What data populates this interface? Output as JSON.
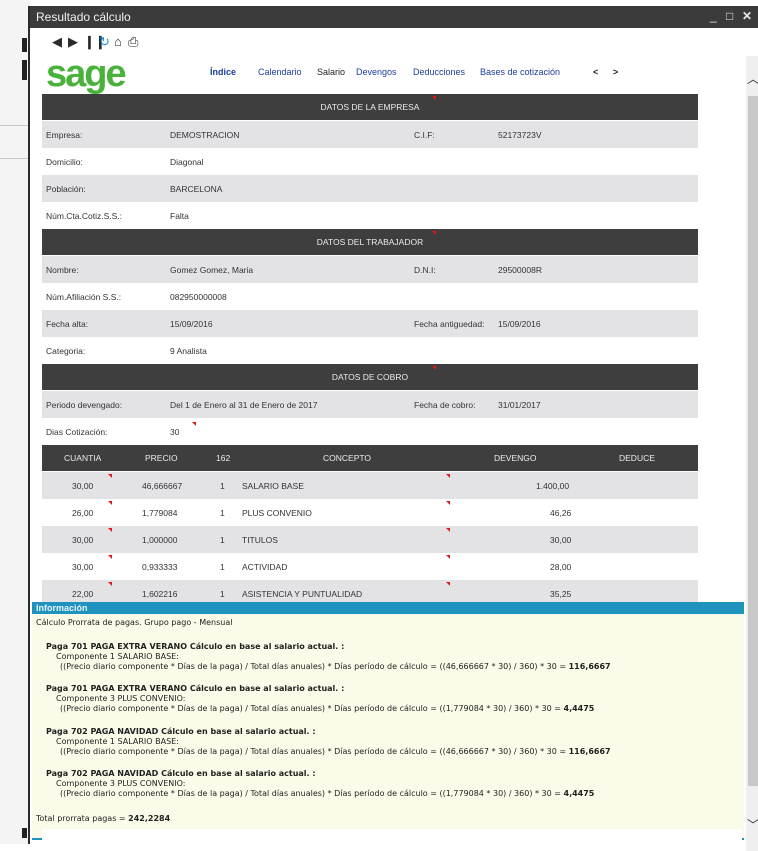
{
  "window": {
    "title": "Resultado cálculo",
    "controls": [
      "_",
      "□",
      "✕"
    ]
  },
  "toolbar": {
    "icons": [
      "back-icon",
      "forward-icon",
      "pause-icon",
      "refresh-icon",
      "home-icon",
      "print-icon"
    ]
  },
  "brand": {
    "logo": "sage",
    "color": "#48b23a"
  },
  "nav": {
    "items": [
      "Índice",
      "Calendario",
      "Salario",
      "Devengos",
      "Deducciones",
      "Bases de cotización"
    ],
    "prev": "<",
    "next": ">"
  },
  "empresa": {
    "header": "DATOS DE LA EMPRESA",
    "empresa_label": "Empresa:",
    "empresa_value": "DEMOSTRACION",
    "cif_label": "C.I.F:",
    "cif_value": "52173723V",
    "domicilio_label": "Domicilio:",
    "domicilio_value": "Diagonal",
    "poblacion_label": "Población:",
    "poblacion_value": "BARCELONA",
    "numcta_label": "Núm.Cta.Cotiz.S.S.:",
    "numcta_value": "Falta"
  },
  "trabajador": {
    "header": "DATOS DEL TRABAJADOR",
    "nombre_label": "Nombre:",
    "nombre_value": "Gomez Gomez, Maria",
    "dni_label": "D.N.I:",
    "dni_value": "29500008R",
    "afiliacion_label": "Núm.Afiliación S.S.:",
    "afiliacion_value": "082950000008",
    "alta_label": "Fecha alta:",
    "alta_value": "15/09/2016",
    "antiguedad_label": "Fecha antiguedad:",
    "antiguedad_value": "15/09/2016",
    "categoria_label": "Categoria:",
    "categoria_value": "9 Analista"
  },
  "cobro": {
    "header": "DATOS DE COBRO",
    "periodo_label": "Periodo devengado:",
    "periodo_value": "Del 1 de Enero al 31 de Enero de 2017",
    "fecha_label": "Fecha de cobro:",
    "fecha_value": "31/01/2017",
    "dias_label": "Dias Cotización:",
    "dias_value": "30"
  },
  "conceptos": {
    "headers": {
      "cuantia": "CUANTIA",
      "precio": "PRECIO",
      "code": "162",
      "concepto": "CONCEPTO",
      "devengo": "DEVENGO",
      "deduce": "DEDUCE"
    },
    "rows": [
      {
        "cuantia": "30,00",
        "precio": "46,666667",
        "n": "1",
        "concepto": "SALARIO BASE",
        "devengo": "1.400,00"
      },
      {
        "cuantia": "26,00",
        "precio": "1,779084",
        "n": "1",
        "concepto": "PLUS CONVENIO",
        "devengo": "46,26"
      },
      {
        "cuantia": "30,00",
        "precio": "1,000000",
        "n": "1",
        "concepto": "TITULOS",
        "devengo": "30,00"
      },
      {
        "cuantia": "30,00",
        "precio": "0,933333",
        "n": "1",
        "concepto": "ACTIVIDAD",
        "devengo": "28,00"
      },
      {
        "cuantia": "22,00",
        "precio": "1,602216",
        "n": "1",
        "concepto": "ASISTENCIA Y PUNTUALIDAD",
        "devengo": "35,25"
      }
    ]
  },
  "info": {
    "title": "Información",
    "subtitle": "Cálculo Prorrata de pagas. Grupo pago - Mensual",
    "blocks": [
      {
        "heading": "Paga 701 PAGA EXTRA VERANO Cálculo en base al salario actual. :",
        "component": "Componente 1 SALARIO BASE:",
        "formula": "((Precio diario componente * Días de la paga) / Total días anuales) * Días período de cálculo = ((46,666667 * 30) / 360) * 30 = ",
        "result": "116,6667"
      },
      {
        "heading": "Paga 701 PAGA EXTRA VERANO Cálculo en base al salario actual. :",
        "component": "Componente 3 PLUS CONVENIO:",
        "formula": "((Precio diario componente * Días de la paga) / Total días anuales) * Días período de cálculo = ((1,779084 * 30) / 360) * 30 = ",
        "result": "4,4475"
      },
      {
        "heading": "Paga 702 PAGA NAVIDAD Cálculo en base al salario actual. :",
        "component": "Componente 1 SALARIO BASE:",
        "formula": "((Precio diario componente * Días de la paga) / Total días anuales) * Días período de cálculo = ((46,666667 * 30) / 360) * 30 = ",
        "result": "116,6667"
      },
      {
        "heading": "Paga 702 PAGA NAVIDAD Cálculo en base al salario actual. :",
        "component": "Componente 3 PLUS CONVENIO:",
        "formula": "((Precio diario componente * Días de la paga) / Total días anuales) * Días período de cálculo = ((1,779084 * 30) / 360) * 30 = ",
        "result": "4,4475"
      }
    ],
    "total_label": "Total prorrata pagas = ",
    "total_value": "242,2284"
  }
}
